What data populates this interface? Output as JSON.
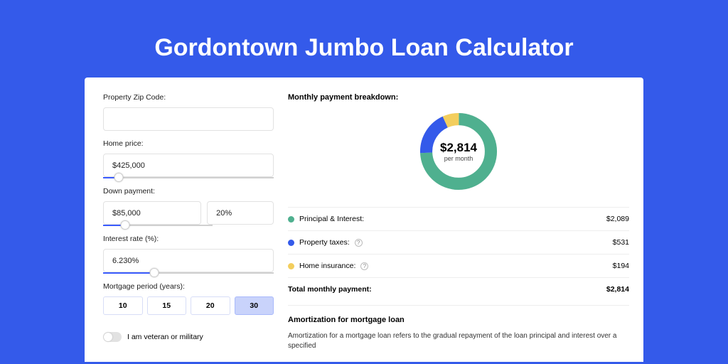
{
  "theme": {
    "primary": "#345AEA",
    "green": "#4FB08F",
    "blue": "#345AEA",
    "yellow": "#F3CE5D"
  },
  "header": {
    "title": "Gordontown Jumbo Loan Calculator"
  },
  "form": {
    "zip_label": "Property Zip Code:",
    "zip_value": "",
    "home_price_label": "Home price:",
    "home_price_value": "$425,000",
    "home_price_slider_pct": 9,
    "down_payment_label": "Down payment:",
    "down_payment_value": "$85,000",
    "down_payment_pct_value": "20%",
    "down_payment_slider_pct": 20,
    "interest_label": "Interest rate (%):",
    "interest_value": "6.230%",
    "interest_slider_pct": 30,
    "period_label": "Mortgage period (years):",
    "periods": [
      "10",
      "15",
      "20",
      "30"
    ],
    "period_selected": "30",
    "veteran_label": "I am veteran or military"
  },
  "breakdown": {
    "title": "Monthly payment breakdown:",
    "center_amount": "$2,814",
    "center_unit": "per month",
    "items": [
      {
        "label": "Principal & Interest:",
        "value": "$2,089",
        "dot": "#4FB08F",
        "info": false
      },
      {
        "label": "Property taxes:",
        "value": "$531",
        "dot": "#345AEA",
        "info": true
      },
      {
        "label": "Home insurance:",
        "value": "$194",
        "dot": "#F3CE5D",
        "info": true
      }
    ],
    "total_label": "Total monthly payment:",
    "total_value": "$2,814"
  },
  "amort": {
    "title": "Amortization for mortgage loan",
    "text": "Amortization for a mortgage loan refers to the gradual repayment of the loan principal and interest over a specified"
  },
  "chart_data": {
    "type": "pie",
    "title": "Monthly payment breakdown",
    "categories": [
      "Principal & Interest",
      "Property taxes",
      "Home insurance"
    ],
    "values": [
      2089,
      531,
      194
    ],
    "colors": [
      "#4FB08F",
      "#345AEA",
      "#F3CE5D"
    ],
    "center_label": "$2,814 per month"
  }
}
